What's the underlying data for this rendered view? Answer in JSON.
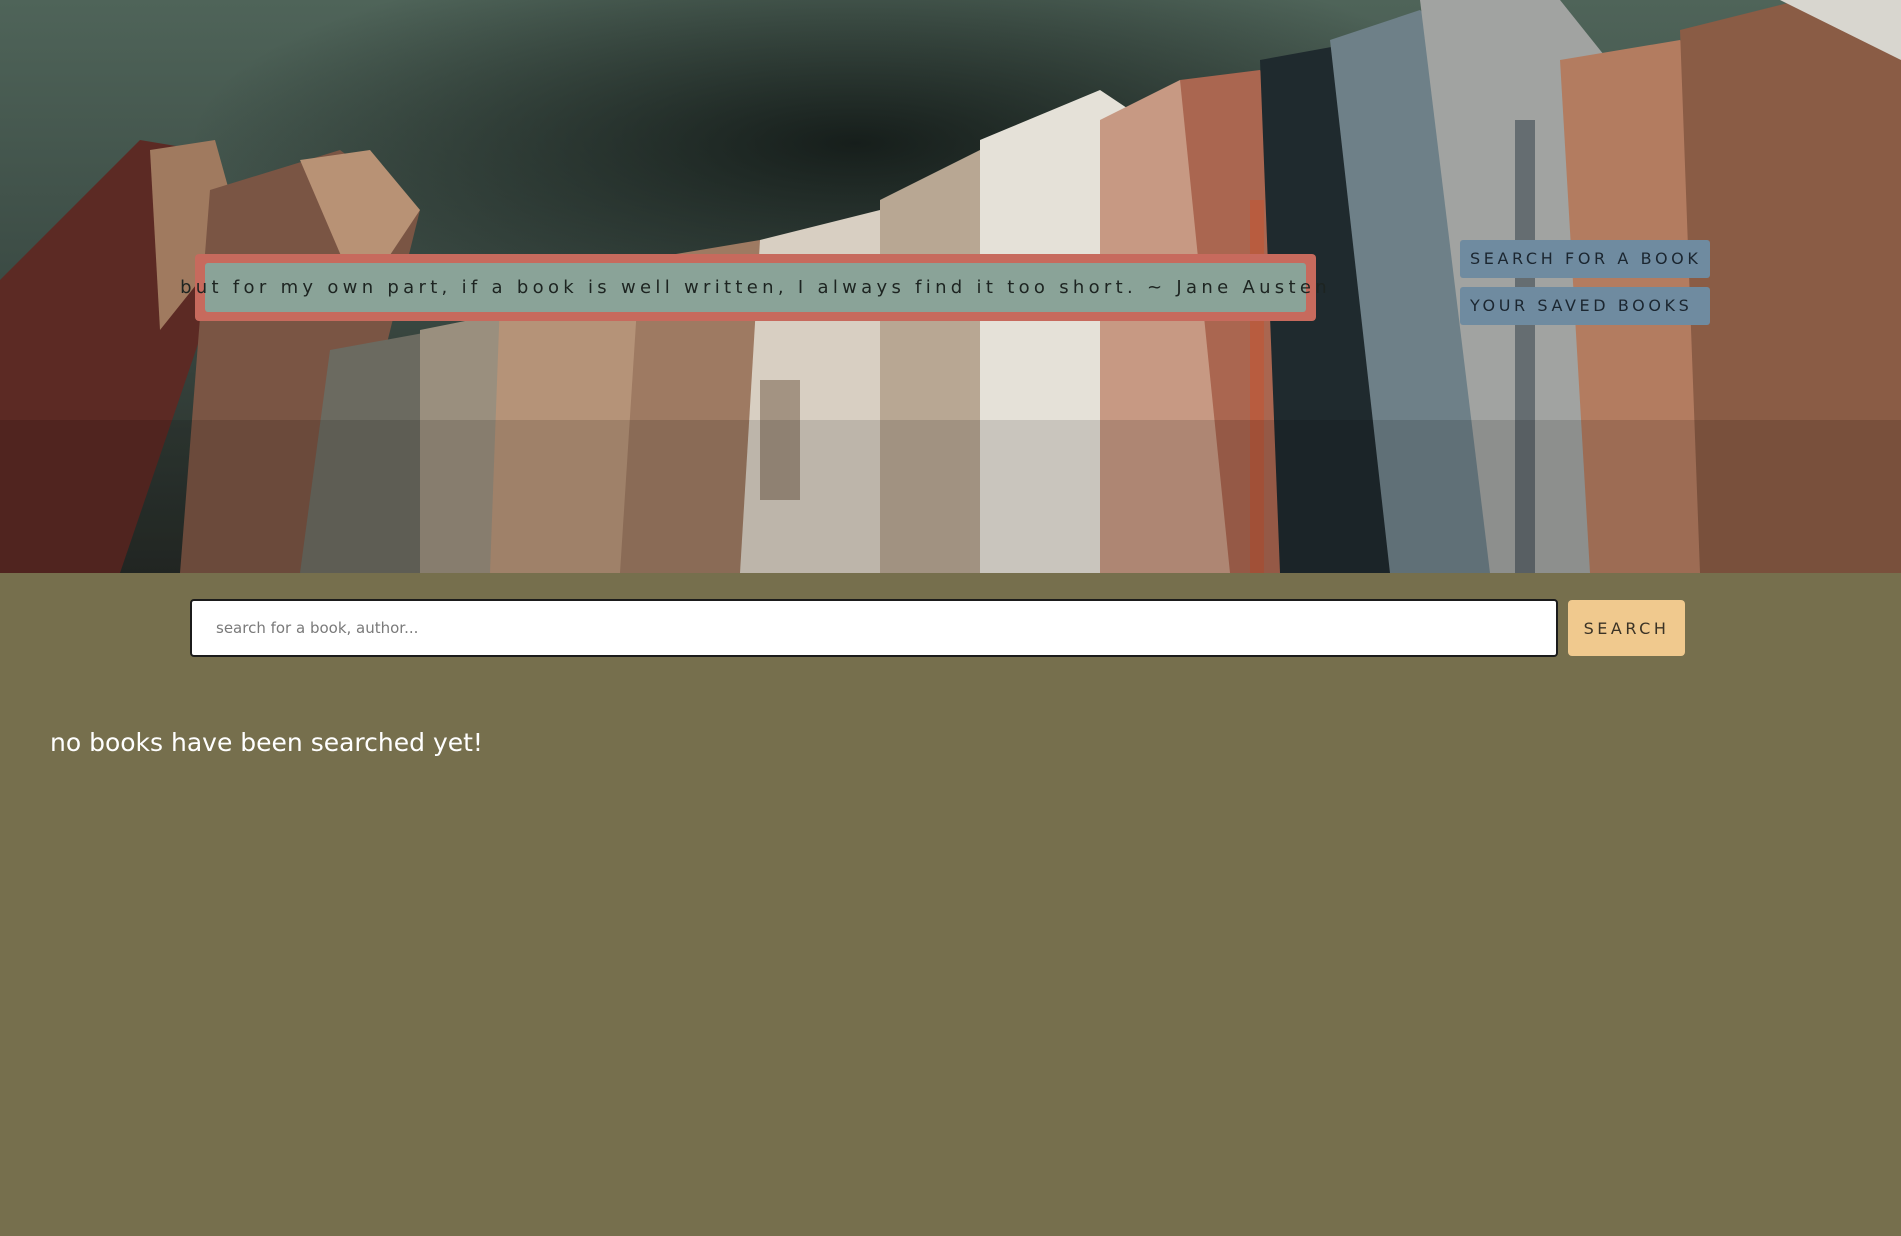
{
  "hero": {
    "image_icon": "bookshelf-photo",
    "quote": "but for my own part, if a book is well written, I always find it too short. ~ Jane Austen"
  },
  "nav": {
    "items": [
      {
        "label": "SEARCH FOR A BOOK"
      },
      {
        "label": "YOUR SAVED BOOKS"
      }
    ]
  },
  "search": {
    "placeholder": "search for a book, author...",
    "value": "",
    "button_label": "SEARCH"
  },
  "results": {
    "empty_message": "no books have been searched yet!"
  },
  "colors": {
    "page_background": "#766f4d",
    "quote_frame": "#c76a5d",
    "quote_fill": "#8aa398",
    "nav_button": "#6f8ba0",
    "search_button": "#f0c98e"
  }
}
